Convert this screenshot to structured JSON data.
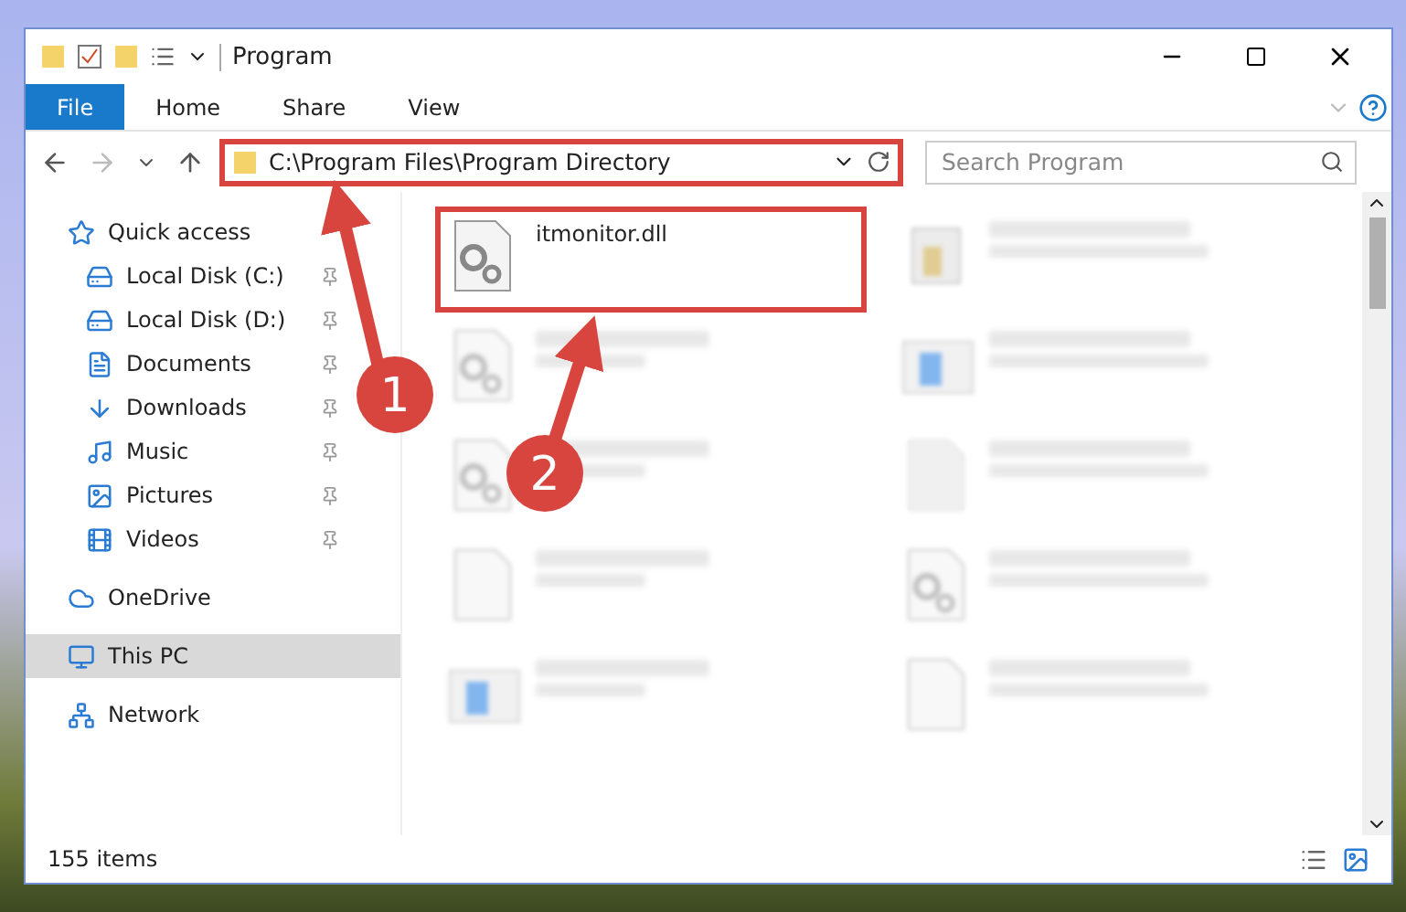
{
  "window": {
    "title": "Program"
  },
  "ribbon_tabs": [
    {
      "label": "File",
      "selected": true
    },
    {
      "label": "Home",
      "selected": false
    },
    {
      "label": "Share",
      "selected": false
    },
    {
      "label": "View",
      "selected": false
    }
  ],
  "address_bar": {
    "path": "C:\\Program Files\\Program Directory",
    "highlighted": true
  },
  "search": {
    "placeholder": "Search Program"
  },
  "sidebar": {
    "items": [
      {
        "label": "Quick access",
        "selected": false,
        "children": [
          {
            "label": "Local Disk (C:)",
            "pinned": true,
            "selected": false
          },
          {
            "label": "Local Disk (D:)",
            "pinned": true,
            "selected": false
          },
          {
            "label": "Documents",
            "pinned": true,
            "selected": false
          },
          {
            "label": "Downloads",
            "pinned": true,
            "selected": false
          },
          {
            "label": "Music",
            "pinned": true,
            "selected": false
          },
          {
            "label": "Pictures",
            "pinned": true,
            "selected": false
          },
          {
            "label": "Videos",
            "pinned": true,
            "selected": false
          }
        ]
      },
      {
        "label": "OneDrive",
        "selected": false
      },
      {
        "label": "This PC",
        "selected": true
      },
      {
        "label": "Network",
        "selected": false
      }
    ]
  },
  "files": [
    {
      "kind": "file",
      "name": "itmonitor.dll",
      "highlighted": true
    },
    {
      "kind": "blurred"
    },
    {
      "kind": "blurred"
    },
    {
      "kind": "blurred"
    },
    {
      "kind": "blurred"
    },
    {
      "kind": "blurred"
    },
    {
      "kind": "blurred"
    },
    {
      "kind": "blurred"
    },
    {
      "kind": "blurred"
    },
    {
      "kind": "blurred"
    }
  ],
  "status_bar": {
    "item_count": "155 items"
  },
  "annotations": [
    {
      "number": "1"
    },
    {
      "number": "2"
    }
  ]
}
